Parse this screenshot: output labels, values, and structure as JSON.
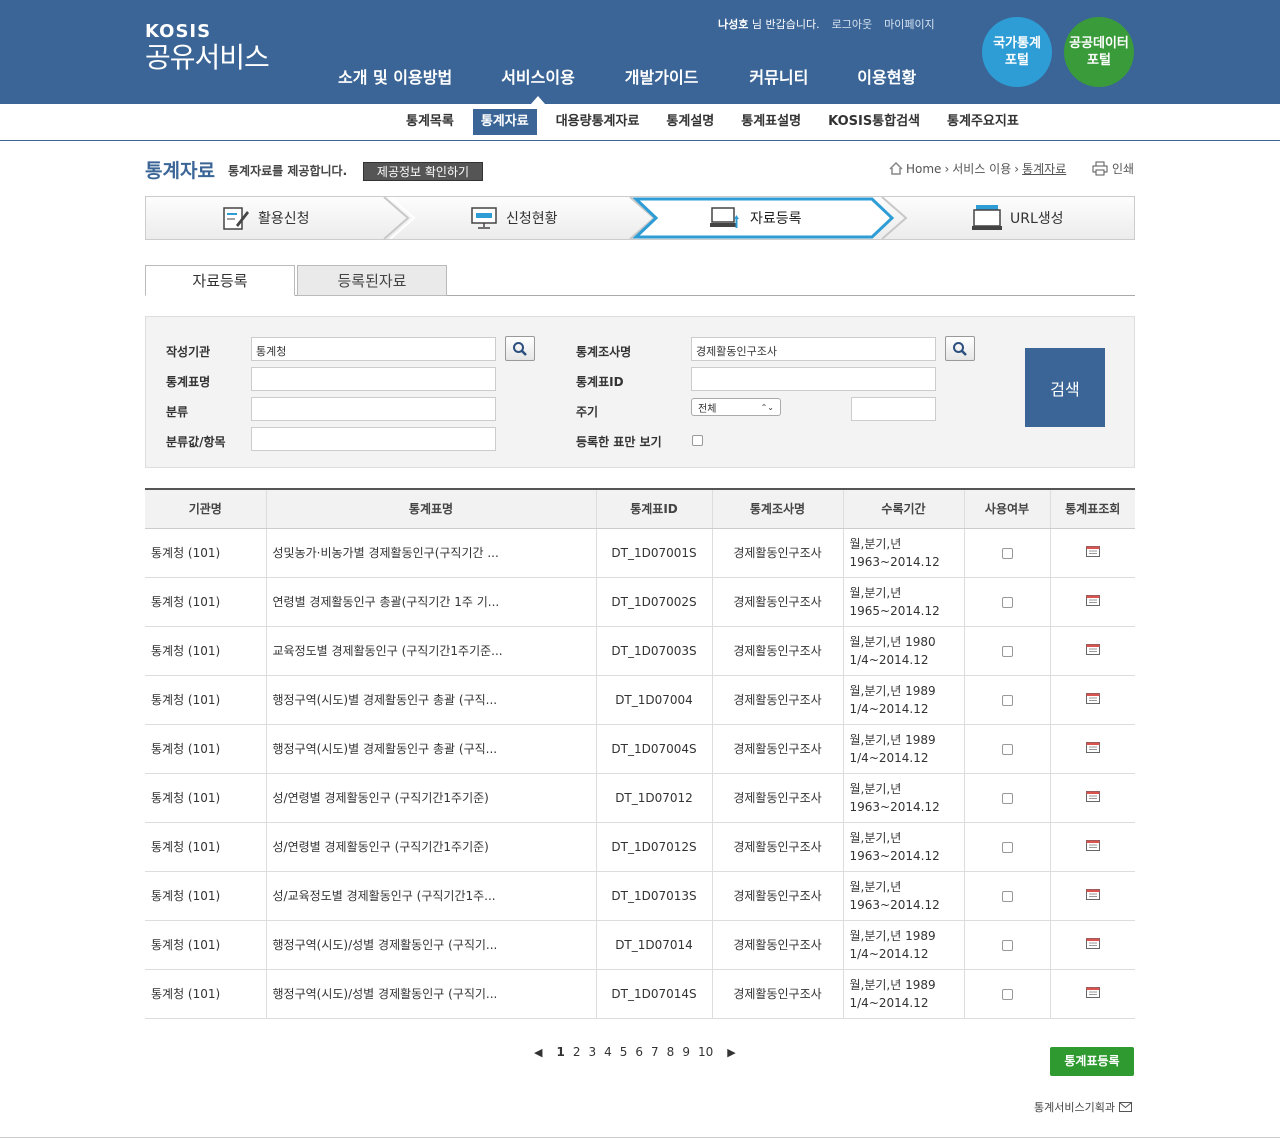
{
  "header": {
    "logo_top": "KOSIS",
    "logo_main": "공유서비스",
    "user_name": "나성호",
    "greeting": " 님 반갑습니다.",
    "logout": "로그아웃",
    "mypage": "마이페이지",
    "gnb": [
      "소개 및 이용방법",
      "서비스이용",
      "개발가이드",
      "커뮤니티",
      "이용현황"
    ],
    "portal1": "국가통계\n포털",
    "portal2": "공공데이터\n포털"
  },
  "subnav": [
    "통계목록",
    "통계자료",
    "대용량통계자료",
    "통계설명",
    "통계표설명",
    "KOSIS통합검색",
    "통계주요지표"
  ],
  "page": {
    "title": "통계자료",
    "desc": "통계자료를 제공합니다.",
    "info_button": "제공정보 확인하기",
    "breadcrumb": [
      "Home",
      "서비스 이용",
      "통계자료"
    ],
    "print": "인쇄"
  },
  "steps": [
    "활용신청",
    "신청현황",
    "자료등록",
    "URL생성"
  ],
  "tabs": [
    "자료등록",
    "등록된자료"
  ],
  "search": {
    "org_label": "작성기관",
    "org_value": "통계청",
    "table_name_label": "통계표명",
    "category_label": "분류",
    "item_label": "분류값/항목",
    "survey_label": "통계조사명",
    "survey_value": "경제활동인구조사",
    "table_id_label": "통계표ID",
    "cycle_label": "주기",
    "cycle_value": "전체",
    "registered_label": "등록한 표만 보기",
    "button": "검색"
  },
  "table": {
    "headers": [
      "기관명",
      "통계표명",
      "통계표ID",
      "통계조사명",
      "수록기간",
      "사용여부",
      "통계표조회"
    ],
    "rows": [
      {
        "org": "통계청 (101)",
        "name": "성및농가·비농가별 경제활동인구(구직기간 ...",
        "id": "DT_1D07001S",
        "survey": "경제활동인구조사",
        "period1": "월,분기,년",
        "period2": "1963~2014.12"
      },
      {
        "org": "통계청 (101)",
        "name": "연령별 경제활동인구 총괄(구직기간 1주 기...",
        "id": "DT_1D07002S",
        "survey": "경제활동인구조사",
        "period1": "월,분기,년",
        "period2": "1965~2014.12"
      },
      {
        "org": "통계청 (101)",
        "name": "교육정도별 경제활동인구 (구직기간1주기준...",
        "id": "DT_1D07003S",
        "survey": "경제활동인구조사",
        "period1": "월,분기,년 1980",
        "period2": "1/4~2014.12"
      },
      {
        "org": "통계청 (101)",
        "name": "행정구역(시도)별 경제활동인구 총괄 (구직...",
        "id": "DT_1D07004",
        "survey": "경제활동인구조사",
        "period1": "월,분기,년 1989",
        "period2": "1/4~2014.12"
      },
      {
        "org": "통계청 (101)",
        "name": "행정구역(시도)별 경제활동인구 총괄 (구직...",
        "id": "DT_1D07004S",
        "survey": "경제활동인구조사",
        "period1": "월,분기,년 1989",
        "period2": "1/4~2014.12"
      },
      {
        "org": "통계청 (101)",
        "name": "성/연령별 경제활동인구 (구직기간1주기준)",
        "id": "DT_1D07012",
        "survey": "경제활동인구조사",
        "period1": "월,분기,년",
        "period2": "1963~2014.12"
      },
      {
        "org": "통계청 (101)",
        "name": "성/연령별 경제활동인구 (구직기간1주기준)",
        "id": "DT_1D07012S",
        "survey": "경제활동인구조사",
        "period1": "월,분기,년",
        "period2": "1963~2014.12"
      },
      {
        "org": "통계청 (101)",
        "name": "성/교육정도별 경제활동인구 (구직기간1주...",
        "id": "DT_1D07013S",
        "survey": "경제활동인구조사",
        "period1": "월,분기,년",
        "period2": "1963~2014.12"
      },
      {
        "org": "통계청 (101)",
        "name": "행정구역(시도)/성별 경제활동인구 (구직기...",
        "id": "DT_1D07014",
        "survey": "경제활동인구조사",
        "period1": "월,분기,년 1989",
        "period2": "1/4~2014.12"
      },
      {
        "org": "통계청 (101)",
        "name": "행정구역(시도)/성별 경제활동인구 (구직기...",
        "id": "DT_1D07014S",
        "survey": "경제활동인구조사",
        "period1": "월,분기,년 1989",
        "period2": "1/4~2014.12"
      }
    ]
  },
  "pagination": {
    "pages": [
      "1",
      "2",
      "3",
      "4",
      "5",
      "6",
      "7",
      "8",
      "9",
      "10"
    ],
    "current": "1"
  },
  "register_button": "통계표등록",
  "contact": "통계서비스기획과",
  "colors": {
    "brand": "#3a6596",
    "green": "#2f9a2f",
    "sky": "#2e9dd6"
  }
}
